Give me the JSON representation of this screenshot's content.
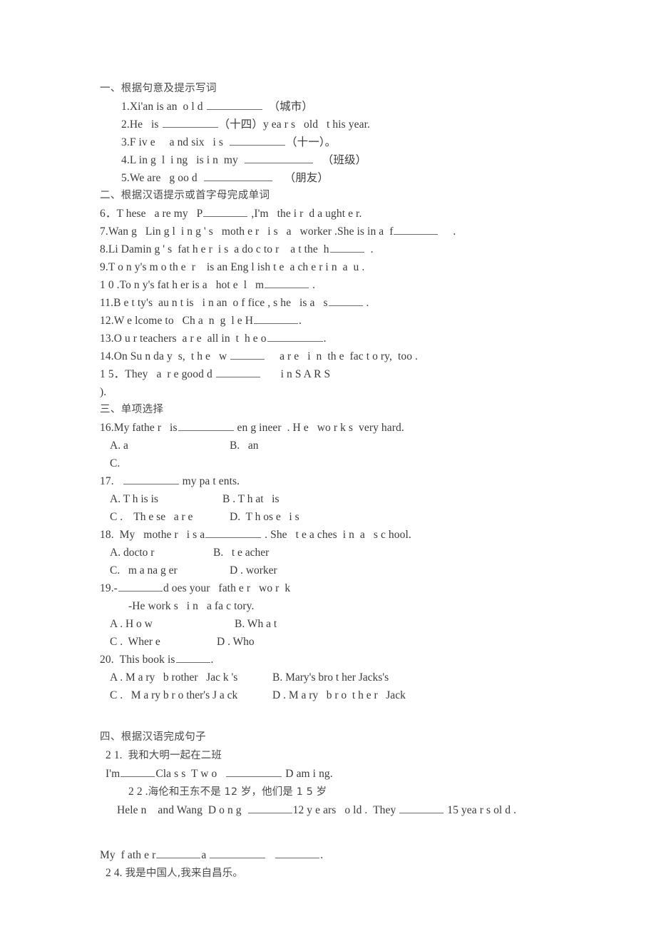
{
  "document": {
    "type": "worksheet",
    "language": "zh-CN/en",
    "background_color": "#ffffff",
    "text_color": "#3a3a3a"
  },
  "sections": {
    "one": {
      "heading": "一、根据句意及提示写词",
      "items": [
        {
          "num": "1.",
          "pre": "Xi'an is an  o l d ",
          "post": "  （城市）"
        },
        {
          "num": "2.",
          "pre": "He   is ",
          "post": "（十四）y ea r s   old   t his year."
        },
        {
          "num": "3.",
          "pre": "F iv e     a nd six   i s  ",
          "post": "（十一）。"
        },
        {
          "num": "4.",
          "pre": "L in g  l  i ng   is i n  my  ",
          "post": "   （班级）"
        },
        {
          "num": "5.",
          "pre": "We are   g oo d  ",
          "post": "    （朋友）"
        }
      ]
    },
    "two": {
      "heading": "二、根据汉语提示或首字母完成单词",
      "items": [
        {
          "num": "6．",
          "pre": "T hese   a re my   P",
          "post": " ,I'm   the i r  d a ught e r."
        },
        {
          "num": "7.",
          "pre": "Wan g   Lin g l  i n g ' s   moth e r   i s   a   worker .She is in a  f",
          "post": "     ."
        },
        {
          "num": "8.",
          "pre": "Li Damin g ' s  fat h e r  i s  a do c to r    a t the  h",
          "post": "  ."
        },
        {
          "num": "9.",
          "pre": "T o n y's m o th e  r    is an Eng l ish t e  a ch e r i n  a  u .",
          "post": ""
        },
        {
          "num": "1 0 .",
          "pre": "To n y's fat h er is a   hot e  l   m",
          "post": " ."
        },
        {
          "num": "11.",
          "pre": "B e t ty's  au n t is   i n an  o f fice , s he   is a   s",
          "post": " ."
        },
        {
          "num": "12.",
          "pre": "W e lcome to   Ch a  n  g  l e H",
          "post": "."
        },
        {
          "num": "13.",
          "pre": "O u r teachers  a r e  all in  t  h e o",
          "post": "."
        },
        {
          "num": "14.",
          "pre": "On Su n da y  s,  t h e   w ",
          "post": "     a r e   i  n  th e  fac t o ry,  too ."
        },
        {
          "num": "1 5．",
          "pre": "They   a  r e good d ",
          "post": "       i n S A R S"
        },
        {
          "num": "",
          "pre": ").",
          "post": ""
        }
      ]
    },
    "three": {
      "heading": "三、单项选择",
      "questions": [
        {
          "num": "16.",
          "stem_pre": "My fathe r   is",
          "stem_post": " en g ineer  . H e   wo r k s  very hard.",
          "options": [
            {
              "label": "A. a",
              "label2": "B.   an"
            },
            {
              "label": "C.",
              "label2": ""
            }
          ]
        },
        {
          "num": "17.",
          "stem_pre": "   ",
          "stem_post": " my pa t ents.",
          "options": [
            {
              "label": "A. T h is is",
              "label2": "B . T h at   is"
            },
            {
              "label": "C .    Th e se   a r e",
              "label2": "D.  T h os e   i s"
            }
          ]
        },
        {
          "num": "18.",
          "stem_pre": "My   mothe r   i s a",
          "stem_post": " . She   t e a ches  i n  a   s c hool.",
          "options": [
            {
              "label": "A. docto r",
              "label2": "B.   t e acher"
            },
            {
              "label": "C.   m a na g er",
              "label2": "D . worker"
            }
          ]
        },
        {
          "num": "19.-",
          "stem_pre": "",
          "stem_post": "d oes your   fath e r   wo r  k",
          "answer_line": "-He work s   i n   a fa c tory.",
          "options": [
            {
              "label": "A . H o w",
              "label2": "B. Wh a t"
            },
            {
              "label": "C .  Wher e",
              "label2": "D . Who"
            }
          ]
        },
        {
          "num": "20.",
          "stem_pre": "This book is",
          "stem_post": ".",
          "options": [
            {
              "label": "A . M a ry   b rother   Jac k 's",
              "label2": "B. Mary's bro t her Jacks's"
            },
            {
              "label": "C .   M a ry b r o ther's J a ck",
              "label2": "D . M a ry   b r o  t h e r   Jack"
            }
          ]
        }
      ]
    },
    "four": {
      "heading": "四、根据汉语完成句子",
      "items": [
        {
          "num": "2 1.",
          "cn": "我和大明一起在二班"
        },
        {
          "num": "",
          "en_a": "I'm",
          "en_b": "Cla s s  T w o   ",
          "en_c": " D am i ng."
        },
        {
          "num": "2 2 .",
          "cn": "海伦和王东不是 12 岁，他们是 1 5 岁"
        },
        {
          "num": "",
          "en_a": "Hele n    and Wang  D o n g  ",
          "en_b": "12 y e ars   o ld .  They ",
          "en_c": " 15 yea r s ol d ."
        },
        {
          "num": "",
          "en_a": "My  f ath e r",
          "en_b": "a ",
          "en_c": "   ",
          "en_d": "."
        },
        {
          "num": "2 4.",
          "cn": "我是中国人,我来自昌乐。"
        }
      ]
    }
  }
}
